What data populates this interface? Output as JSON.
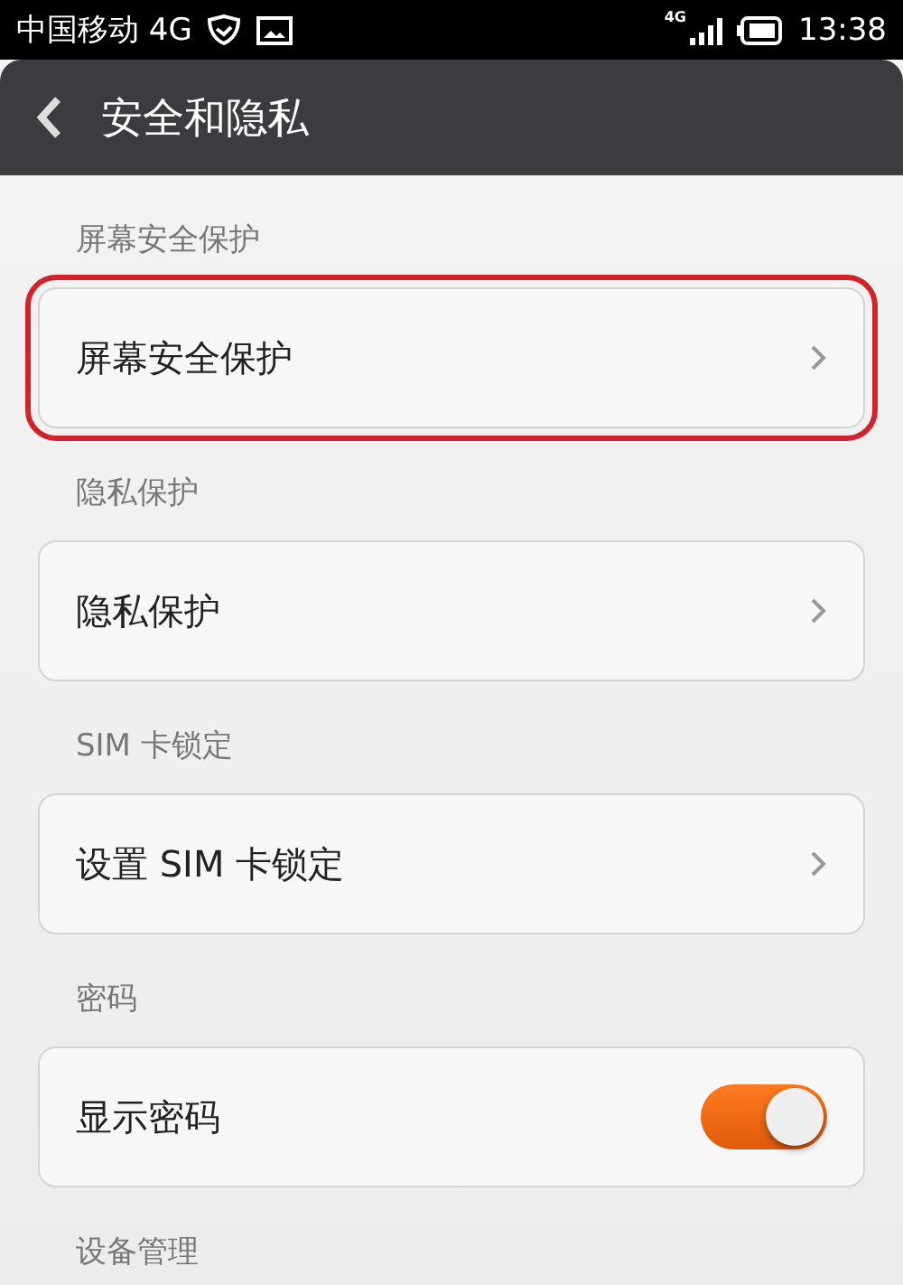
{
  "status_bar": {
    "carrier": "中国移动 4G",
    "network": "4G",
    "time": "13:38"
  },
  "header": {
    "title": "安全和隐私"
  },
  "sections": [
    {
      "heading": "屏幕安全保护",
      "items": [
        {
          "kind": "link",
          "label": "屏幕安全保护",
          "highlighted": true
        }
      ]
    },
    {
      "heading": "隐私保护",
      "items": [
        {
          "kind": "link",
          "label": "隐私保护",
          "highlighted": false
        }
      ]
    },
    {
      "heading": "SIM 卡锁定",
      "items": [
        {
          "kind": "link",
          "label": "设置 SIM 卡锁定",
          "highlighted": false
        }
      ]
    },
    {
      "heading": "密码",
      "items": [
        {
          "kind": "toggle",
          "label": "显示密码",
          "on": true,
          "highlighted": false
        }
      ]
    },
    {
      "heading": "设备管理"
    }
  ]
}
